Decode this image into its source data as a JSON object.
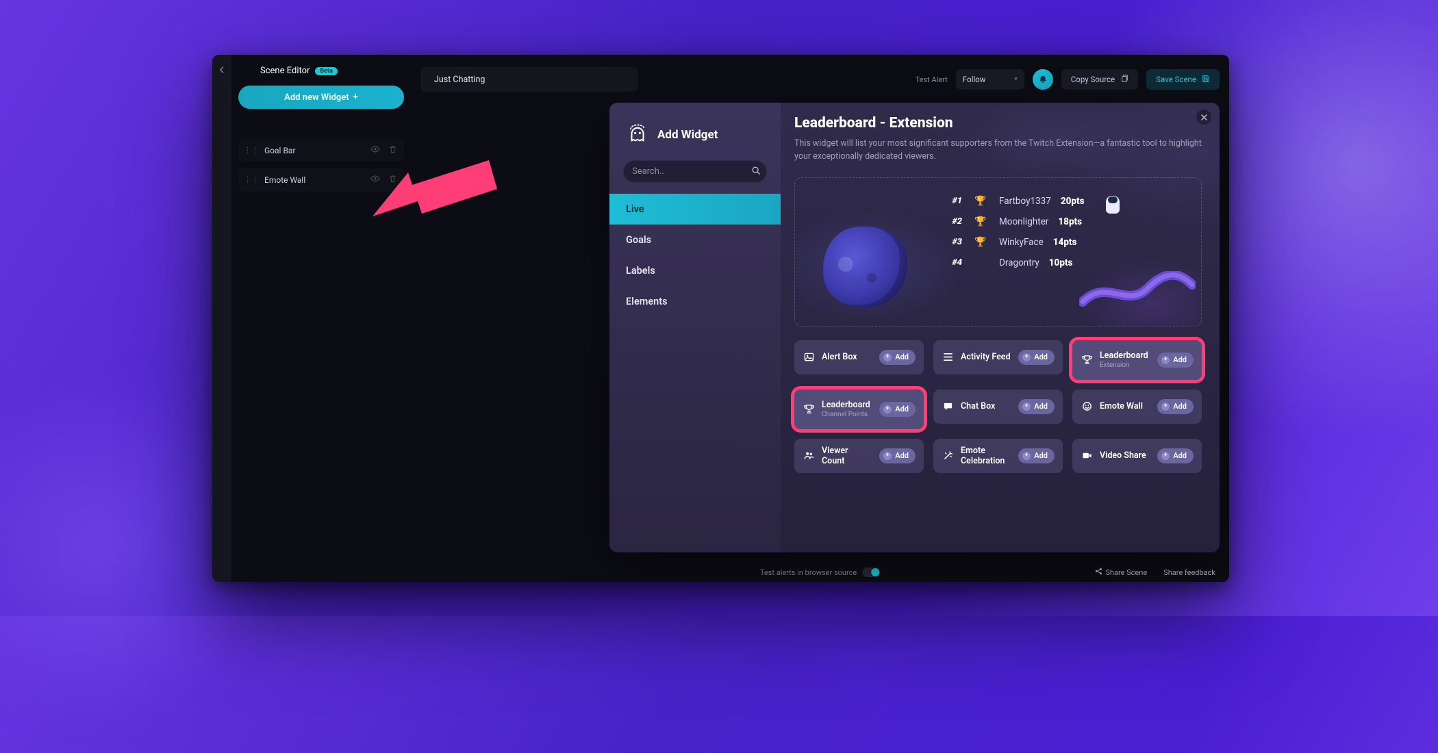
{
  "sidebar": {
    "title": "Scene Editor",
    "beta_label": "Beta",
    "add_widget_label": "Add new Widget",
    "widgets": [
      {
        "name": "Goal Bar"
      },
      {
        "name": "Emote Wall"
      }
    ]
  },
  "topbar": {
    "scene_tab": "Just Chatting",
    "test_alert_label": "Test Alert",
    "alert_type_selected": "Follow",
    "copy_source_label": "Copy Source",
    "save_scene_label": "Save Scene"
  },
  "status": {
    "center_note": "Test alerts in browser source",
    "share_scene": "Share Scene",
    "share_feedback": "Share feedback"
  },
  "modal": {
    "title": "Add Widget",
    "search_placeholder": "Search..",
    "categories": [
      "Live",
      "Goals",
      "Labels",
      "Elements"
    ],
    "active_category": "Live",
    "close_label": "Close",
    "preview": {
      "title": "Leaderboard - Extension",
      "description": "This widget will list your most significant supporters from the Twitch Extension—a fantastic tool to highlight your exceptionally dedicated viewers.",
      "rows": [
        {
          "rank": "#1",
          "name": "Fartboy1337",
          "pts": "20pts"
        },
        {
          "rank": "#2",
          "name": "Moonlighter",
          "pts": "18pts"
        },
        {
          "rank": "#3",
          "name": "WinkyFace",
          "pts": "14pts"
        },
        {
          "rank": "#4",
          "name": "Dragontry",
          "pts": "10pts"
        }
      ]
    },
    "add_label": "Add",
    "cards": [
      {
        "title": "Alert Box",
        "sub": "",
        "icon": "image"
      },
      {
        "title": "Activity Feed",
        "sub": "",
        "icon": "list"
      },
      {
        "title": "Leaderboard",
        "sub": "Extension",
        "icon": "trophy",
        "highlight": true
      },
      {
        "title": "Leaderboard",
        "sub": "Channel Points",
        "icon": "trophy",
        "highlight": true
      },
      {
        "title": "Chat Box",
        "sub": "",
        "icon": "chat"
      },
      {
        "title": "Emote Wall",
        "sub": "",
        "icon": "smile"
      },
      {
        "title": "Viewer Count",
        "sub": "",
        "icon": "people"
      },
      {
        "title": "Emote Celebration",
        "sub": "",
        "icon": "wand"
      },
      {
        "title": "Video Share",
        "sub": "",
        "icon": "video"
      }
    ]
  }
}
